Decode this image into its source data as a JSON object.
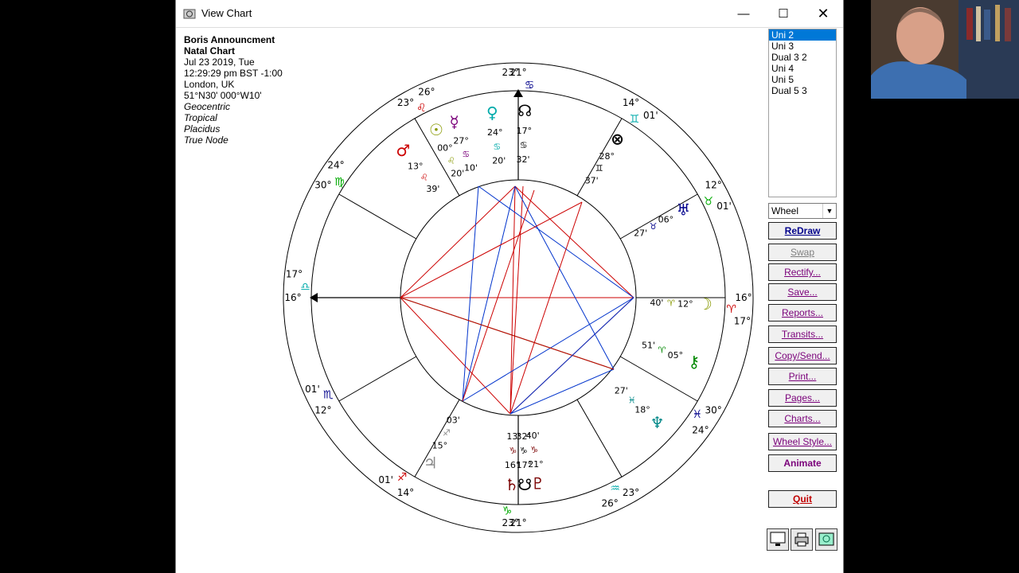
{
  "window": {
    "title": "View Chart"
  },
  "chart_info": {
    "name": "Boris Announcment",
    "type": "Natal Chart",
    "date": "Jul 23 2019, Tue",
    "time": "12:29:29 pm  BST -1:00",
    "place": "London, UK",
    "coords": "51°N30' 000°W10'",
    "opt1": "Geocentric",
    "opt2": "Tropical",
    "opt3": "Placidus",
    "opt4": "True Node"
  },
  "chart_list": [
    "Uni 2",
    "Uni 3",
    "Dual 3 2",
    "Uni 4",
    "Uni 5",
    "Dual 5 3"
  ],
  "chart_list_selected": 0,
  "wheel_style": "Wheel",
  "buttons": {
    "redraw": "ReDraw",
    "swap": "Swap",
    "rectify": "Rectify...",
    "save": "Save...",
    "reports": "Reports...",
    "transits": "Transits...",
    "copysend": "Copy/Send...",
    "print": "Print...",
    "pages": "Pages...",
    "charts": "Charts...",
    "wheelstyle": "Wheel Style...",
    "animate": "Animate",
    "quit": "Quit"
  },
  "cusps": [
    {
      "label": "21°",
      "ang": 270,
      "r": 283,
      "sign": "♋",
      "color": "#00008b"
    },
    {
      "label": "23°",
      "ang": 268,
      "r": 283
    },
    {
      "label": "14°",
      "ang": 300,
      "r": 283,
      "sign": "♊",
      "color": "#00aaaa"
    },
    {
      "label": "01'",
      "ang": 306,
      "r": 283
    },
    {
      "label": "12°",
      "ang": 330,
      "r": 283,
      "sign": "♉",
      "color": "#00aa00"
    },
    {
      "label": "01'",
      "ang": 336,
      "r": 283
    },
    {
      "label": "16°",
      "ang": 0,
      "r": 283,
      "sign": "♈",
      "color": "#cc0000"
    },
    {
      "label": "17°",
      "ang": 6,
      "r": 283
    },
    {
      "label": "30°",
      "ang": 30,
      "r": 283,
      "sign": "♓",
      "color": "#00008b"
    },
    {
      "label": "24°",
      "ang": 36,
      "r": 283
    },
    {
      "label": "23°",
      "ang": 60,
      "r": 283,
      "sign": "♒",
      "color": "#00aaaa"
    },
    {
      "label": "26°",
      "ang": 66,
      "r": 283
    },
    {
      "label": "21°",
      "ang": 90,
      "r": 283,
      "sign": "♑",
      "color": "#00aa00"
    },
    {
      "label": "23°",
      "ang": 92,
      "r": 283
    },
    {
      "label": "14°",
      "ang": 120,
      "r": 283,
      "sign": "♐",
      "color": "#cc0000"
    },
    {
      "label": "01'",
      "ang": 126,
      "r": 283
    },
    {
      "label": "12°",
      "ang": 150,
      "r": 283,
      "sign": "♏",
      "color": "#00008b"
    },
    {
      "label": "01'",
      "ang": 156,
      "r": 283
    },
    {
      "label": "16°",
      "ang": 180,
      "r": 283,
      "sign": "♎",
      "color": "#00aaaa"
    },
    {
      "label": "17°",
      "ang": 186,
      "r": 283
    },
    {
      "label": "30°",
      "ang": 210,
      "r": 283,
      "sign": "♍",
      "color": "#00aa00"
    },
    {
      "label": "24°",
      "ang": 216,
      "r": 283
    },
    {
      "label": "23°",
      "ang": 240,
      "r": 283,
      "sign": "♌",
      "color": "#cc0000"
    },
    {
      "label": "26°",
      "ang": 246,
      "r": 283
    }
  ],
  "planets": [
    {
      "glyph": "♂",
      "color": "#cc0000",
      "deg": "13°",
      "sign": "♌",
      "min": "39'"
    },
    {
      "glyph": "☉",
      "color": "#889900",
      "deg": "00°",
      "sign": "♌",
      "min": "20'"
    },
    {
      "glyph": "☿",
      "color": "#7a007a",
      "deg": "27°",
      "sign": "♋",
      "min": "10'"
    },
    {
      "glyph": "♀",
      "color": "#00aaaa",
      "deg": "24°",
      "sign": "♋",
      "min": "20'"
    },
    {
      "glyph": "☊",
      "color": "#000000",
      "deg": "17°",
      "sign": "♋",
      "min": "32'"
    },
    {
      "glyph": "⊗",
      "color": "#000000",
      "deg": "28°",
      "sign": "♊",
      "min": "37'"
    },
    {
      "glyph": "♅",
      "color": "#00008b",
      "deg": "06°",
      "sign": "♉",
      "min": "27'"
    },
    {
      "glyph": "☽",
      "color": "#889900",
      "deg": "12°",
      "sign": "♈",
      "min": "40'"
    },
    {
      "glyph": "⚷",
      "color": "#008800",
      "deg": "05°",
      "sign": "♈",
      "min": "51'"
    },
    {
      "glyph": "♆",
      "color": "#008888",
      "deg": "18°",
      "sign": "♓",
      "min": "27'"
    },
    {
      "glyph": "♃",
      "color": "#888888",
      "deg": "15°",
      "sign": "♐",
      "min": "03'"
    },
    {
      "glyph": "♄",
      "color": "#7a0000",
      "deg": "16°",
      "sign": "♑",
      "min": "13'"
    },
    {
      "glyph": "☋",
      "color": "#000000",
      "deg": "17°",
      "sign": "♑",
      "min": "32'"
    },
    {
      "glyph": "♇",
      "color": "#7a0000",
      "deg": "21°",
      "sign": "♑",
      "min": "40'"
    }
  ]
}
